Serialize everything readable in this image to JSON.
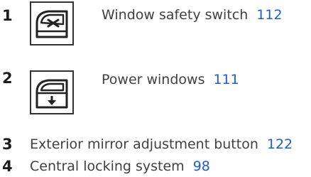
{
  "items": [
    {
      "number": "1",
      "label": "Window safety switch",
      "page_ref": "112",
      "icon": "window-safety-switch-icon"
    },
    {
      "number": "2",
      "label": "Power windows",
      "page_ref": "111",
      "icon": "power-window-icon"
    },
    {
      "number": "3",
      "label": "Exterior mirror adjustment button",
      "page_ref": "122"
    },
    {
      "number": "4",
      "label": "Central locking system",
      "page_ref": "98"
    }
  ]
}
